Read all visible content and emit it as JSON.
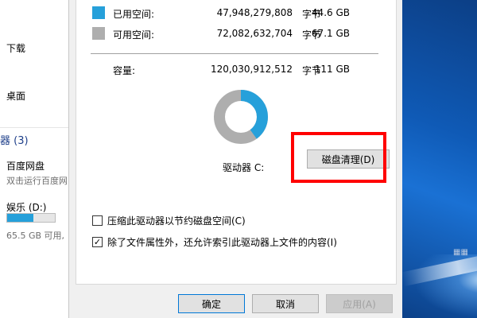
{
  "explorer": {
    "items": [
      "下载",
      "桌面"
    ],
    "section": "器 (3)",
    "drive1_name": "百度网盘",
    "drive1_sub": "双击运行百度网",
    "drive2_name": "娱乐 (D:)",
    "drive2_free": "65.5 GB 可用,",
    "drive2_used_fraction": 0.55
  },
  "dialog": {
    "used": {
      "label": "已用空间:",
      "bytes": "47,948,279,808",
      "unit": "字节",
      "gb": "44.6 GB",
      "color": "#26a0da"
    },
    "free": {
      "label": "可用空间:",
      "bytes": "72,082,632,704",
      "unit": "字节",
      "gb": "67.1 GB",
      "color": "#aeaeae"
    },
    "capacity": {
      "label": "容量:",
      "bytes": "120,030,912,512",
      "unit": "字节",
      "gb": "111 GB"
    },
    "used_fraction": 0.4,
    "drive_label": "驱动器 C:",
    "cleanup_button": "磁盘清理(D)",
    "compress_checkbox": {
      "label": "压缩此驱动器以节约磁盘空间(C)",
      "checked": false
    },
    "index_checkbox": {
      "label": "除了文件属性外，还允许索引此驱动器上文件的内容(I)",
      "checked": true
    },
    "ok_button": "确定",
    "cancel_button": "取消",
    "apply_button": "应用(A)"
  }
}
